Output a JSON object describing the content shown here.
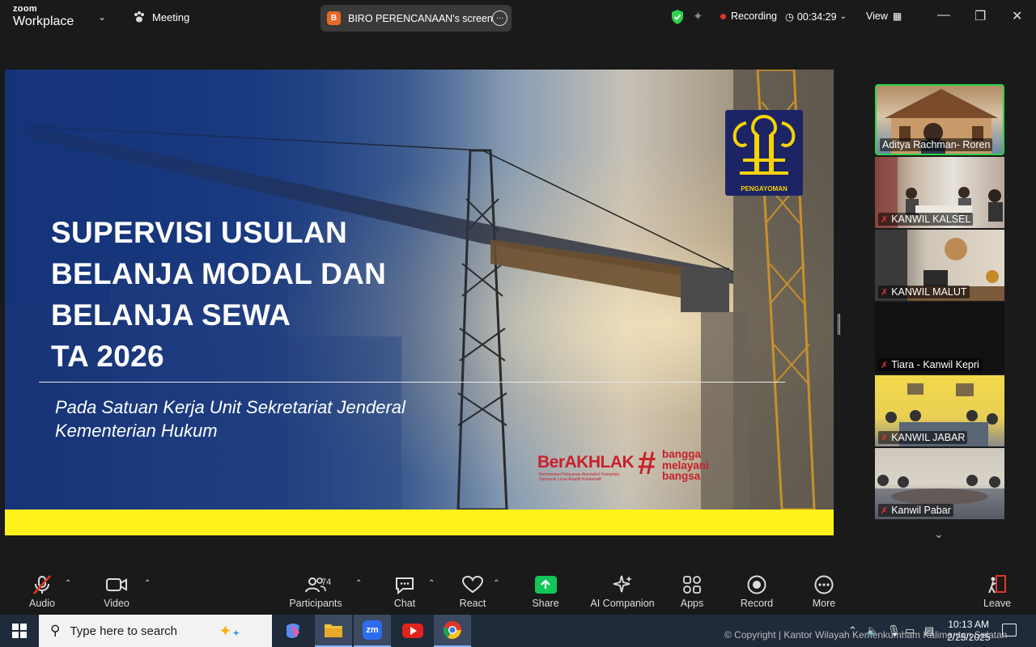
{
  "app": {
    "brand_small": "zoom",
    "brand_big": "Workplace",
    "meeting_label": "Meeting",
    "share_initial": "B",
    "share_title": "BIRO PERENCANAAN's screen",
    "recording_label": "Recording",
    "timer": "00:34:29",
    "view_label": "View"
  },
  "slide": {
    "title_lines": [
      "SUPERVISI USULAN",
      "BELANJA MODAL DAN",
      "BELANJA SEWA",
      "TA 2026"
    ],
    "subtitle_lines": [
      "Pada Satuan Kerja Unit Sekretariat Jenderal",
      "Kementerian Hukum"
    ],
    "logo_caption": "PENGAYOMAN",
    "berakhlak": "BerAKHLAK",
    "berakhlak_sub": "Berorientasi Pelayanan Akuntabel Kompeten Harmonis Loyal Adaptif Kolaboratif",
    "hashtag": "#",
    "hashtag_words": [
      "bangga",
      "melayani",
      "bangsa"
    ]
  },
  "participants": [
    {
      "name": "Aditya Rachman- Roren",
      "muted": false,
      "active": true,
      "scene": "house"
    },
    {
      "name": "KANWIL KALSEL",
      "muted": true,
      "active": false,
      "scene": "room"
    },
    {
      "name": "KANWIL MALUT",
      "muted": true,
      "active": false,
      "scene": "office"
    },
    {
      "name": "Tiara - Kanwil Kepri",
      "muted": true,
      "active": false,
      "scene": "dark"
    },
    {
      "name": "KANWIL JABAR",
      "muted": true,
      "active": false,
      "scene": "yellow"
    },
    {
      "name": "Kanwil Pabar",
      "muted": true,
      "active": false,
      "scene": "meeting"
    }
  ],
  "toolbar": {
    "audio": "Audio",
    "video": "Video",
    "participants": "Participants",
    "participants_count": "74",
    "chat": "Chat",
    "react": "React",
    "share": "Share",
    "ai": "AI Companion",
    "apps": "Apps",
    "record": "Record",
    "more": "More",
    "leave": "Leave"
  },
  "taskbar": {
    "search_placeholder": "Type here to search",
    "copyright": "© Copyright | Kantor Wilayah Kemenkumham Kalimantan Selatan",
    "time": "10:13 AM",
    "date": "2/25/2025"
  },
  "colors": {
    "accent_green": "#2ed14c",
    "record_red": "#e0352b",
    "share_green": "#13c55a",
    "slide_yellow": "#fff21a",
    "berakhlak_red": "#c8202b"
  }
}
